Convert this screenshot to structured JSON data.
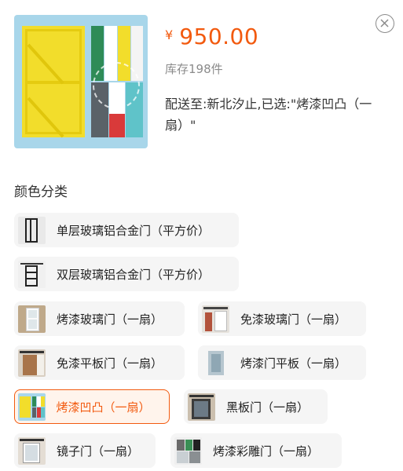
{
  "product": {
    "price_currency": "¥",
    "price_value": "950.00",
    "stock": "库存198件",
    "delivery": "配送至:新北汐止,已选:\"烤漆凹凸（一扇）\""
  },
  "colors": {
    "accent": "#f25a0f",
    "chip_bg": "#f5f5f5",
    "selected_bg": "#fff4ec",
    "thumb_bg": "#a8d6ea"
  },
  "icons": {
    "close": "close-icon"
  },
  "section": {
    "title": "颜色分类"
  },
  "options": [
    {
      "label": "单层玻璃铝合金门（平方价）",
      "thumb": "single-glass-door-thumb",
      "selected": false
    },
    {
      "label": "双层玻璃铝合金门（平方价）",
      "thumb": "double-glass-door-thumb",
      "selected": false
    },
    {
      "label": "烤漆玻璃门（一扇）",
      "thumb": "painted-glass-door-thumb",
      "selected": false
    },
    {
      "label": "免漆玻璃门（一扇）",
      "thumb": "unpainted-glass-door-thumb",
      "selected": false
    },
    {
      "label": "免漆平板门（一扇）",
      "thumb": "unpainted-flat-door-thumb",
      "selected": false
    },
    {
      "label": "烤漆门平板（一扇）",
      "thumb": "painted-flat-door-thumb",
      "selected": false
    },
    {
      "label": "烤漆凹凸（一扇）",
      "thumb": "painted-relief-door-thumb",
      "selected": true
    },
    {
      "label": "黑板门（一扇）",
      "thumb": "blackboard-door-thumb",
      "selected": false
    },
    {
      "label": "镜子门（一扇）",
      "thumb": "mirror-door-thumb",
      "selected": false
    },
    {
      "label": "烤漆彩雕门（一扇）",
      "thumb": "painted-carved-door-thumb",
      "selected": false
    }
  ]
}
